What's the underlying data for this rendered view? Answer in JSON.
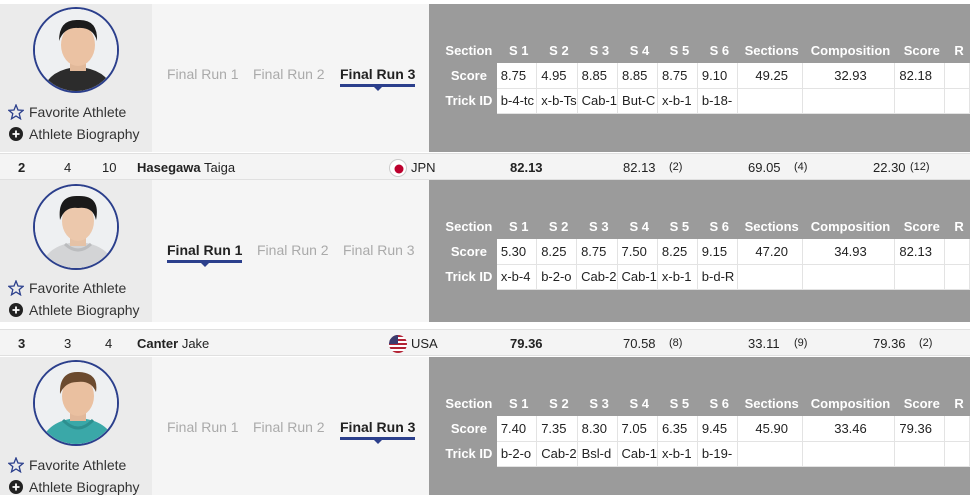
{
  "labels": {
    "favorite": "Favorite Athlete",
    "biography": "Athlete Biography"
  },
  "score_table": {
    "headers": [
      "Section",
      "S 1",
      "S 2",
      "S 3",
      "S 4",
      "S 5",
      "S 6",
      "Sections",
      "Composition",
      "Score",
      "R"
    ],
    "row_labels": {
      "score": "Score",
      "trick": "Trick ID"
    }
  },
  "run_tabs": [
    "Final Run 1",
    "Final Run 2",
    "Final Run 3"
  ],
  "athletes": [
    {
      "active_run": 3,
      "scores": [
        "8.75",
        "4.95",
        "8.85",
        "8.85",
        "8.75",
        "9.10",
        "49.25",
        "32.93",
        "82.18"
      ],
      "tricks": [
        "b-4-tc",
        "x-b-Ts",
        "Cab-1",
        "But-C",
        "x-b-1",
        "b-18-"
      ]
    },
    {
      "rank": "2",
      "col2": "4",
      "col3": "10",
      "last": "Hasegawa",
      "first": "Taiga",
      "country": "JPN",
      "total": "82.13",
      "best": "82.13",
      "best_rank": "(2)",
      "sections": "69.05",
      "sections_rank": "(4)",
      "comp": "22.30",
      "comp_rank": "(12)",
      "active_run": 1,
      "scores": [
        "5.30",
        "8.25",
        "8.75",
        "7.50",
        "8.25",
        "9.15",
        "47.20",
        "34.93",
        "82.13"
      ],
      "tricks": [
        "x-b-4",
        "b-2-o",
        "Cab-2",
        "Cab-1",
        "x-b-1",
        "b-d-R"
      ]
    },
    {
      "rank": "3",
      "col2": "3",
      "col3": "4",
      "last": "Canter",
      "first": "Jake",
      "country": "USA",
      "total": "79.36",
      "best": "70.58",
      "best_rank": "(8)",
      "sections": "33.11",
      "sections_rank": "(9)",
      "comp": "79.36",
      "comp_rank": "(2)",
      "active_run": 3,
      "scores": [
        "7.40",
        "7.35",
        "8.30",
        "7.05",
        "6.35",
        "9.45",
        "45.90",
        "33.46",
        "79.36"
      ],
      "tricks": [
        "b-2-o",
        "Cab-2",
        "Bsl-d",
        "Cab-1",
        "x-b-1",
        "b-19-"
      ]
    }
  ],
  "colors": {
    "accent": "#2b3f8c",
    "grey_panel": "#9b9b9b"
  }
}
